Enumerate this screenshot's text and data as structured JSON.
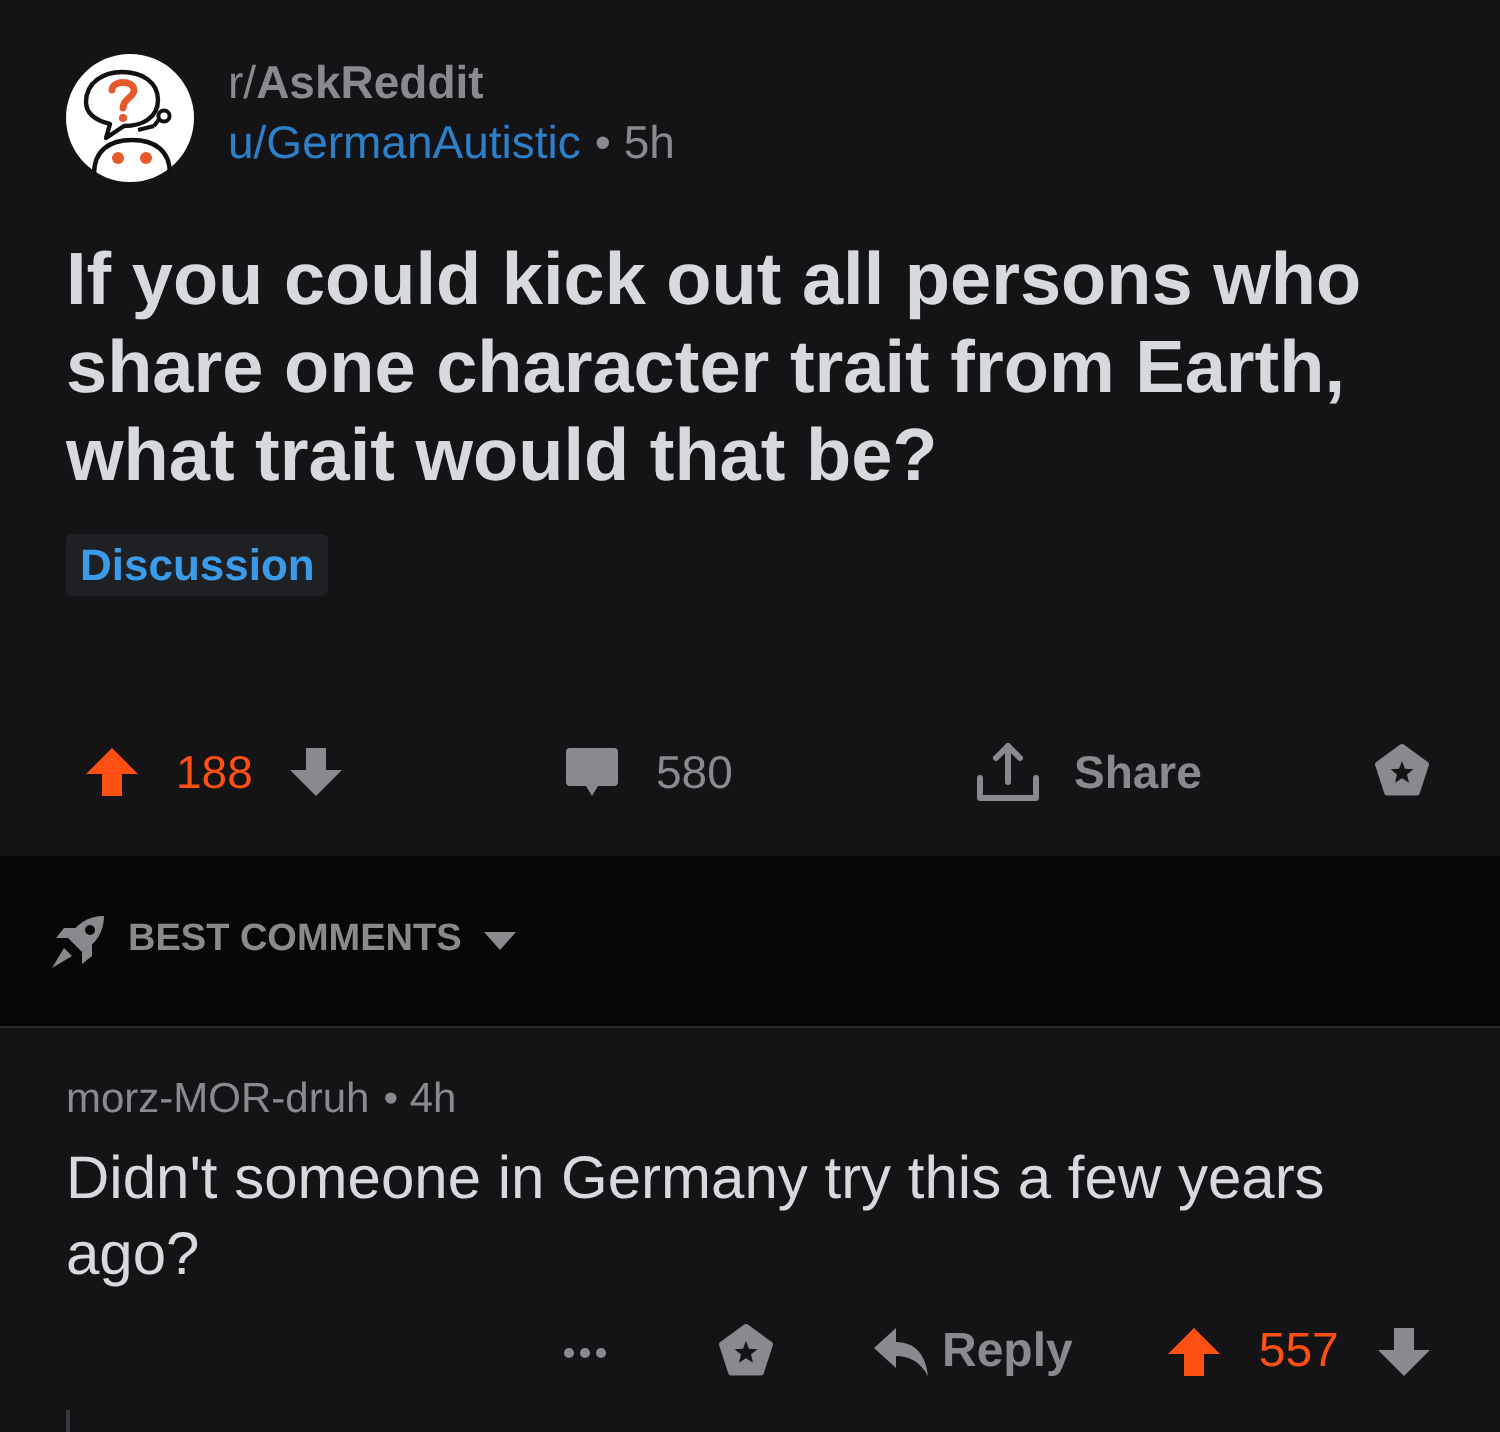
{
  "post": {
    "subreddit": "r/**AskReddit**",
    "author": "u/GermanAutistic",
    "age": "• 5h",
    "title": "If you could kick out all persons who share one character trait from Earth, what trait would that be?",
    "flair": "Discussion",
    "score": "188",
    "upvoted": true,
    "comment_count": "580",
    "share_label": "Share"
  },
  "sort": {
    "label": "BEST COMMENTS"
  },
  "comments": [
    {
      "author": "morz-MOR-druh",
      "age": "• 4h",
      "body": "Didn't someone in Germany try this a few years ago?",
      "reply_label": "Reply",
      "score": "557",
      "upvoted": true
    }
  ]
}
